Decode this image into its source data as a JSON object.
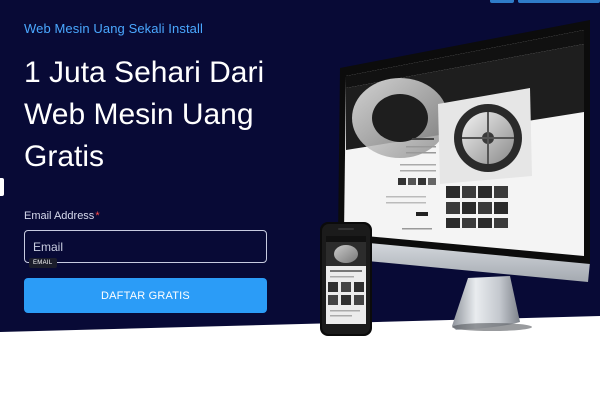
{
  "hero": {
    "eyebrow": "Web Mesin Uang Sekali Install",
    "headline_lines": [
      "1 Juta Sehari Dari",
      "Web Mesin Uang",
      "Gratis"
    ]
  },
  "form": {
    "email_label": "Email Address",
    "required_mark": "*",
    "email_placeholder": "Email",
    "email_value": "",
    "email_tag": "EMAIL",
    "submit_label": "DAFTAR GRATIS"
  },
  "colors": {
    "hero_background": "#080a36",
    "accent_blue": "#2b9cf7",
    "eyebrow_blue": "#4aa8ff",
    "required_red": "#ff4b4b"
  }
}
